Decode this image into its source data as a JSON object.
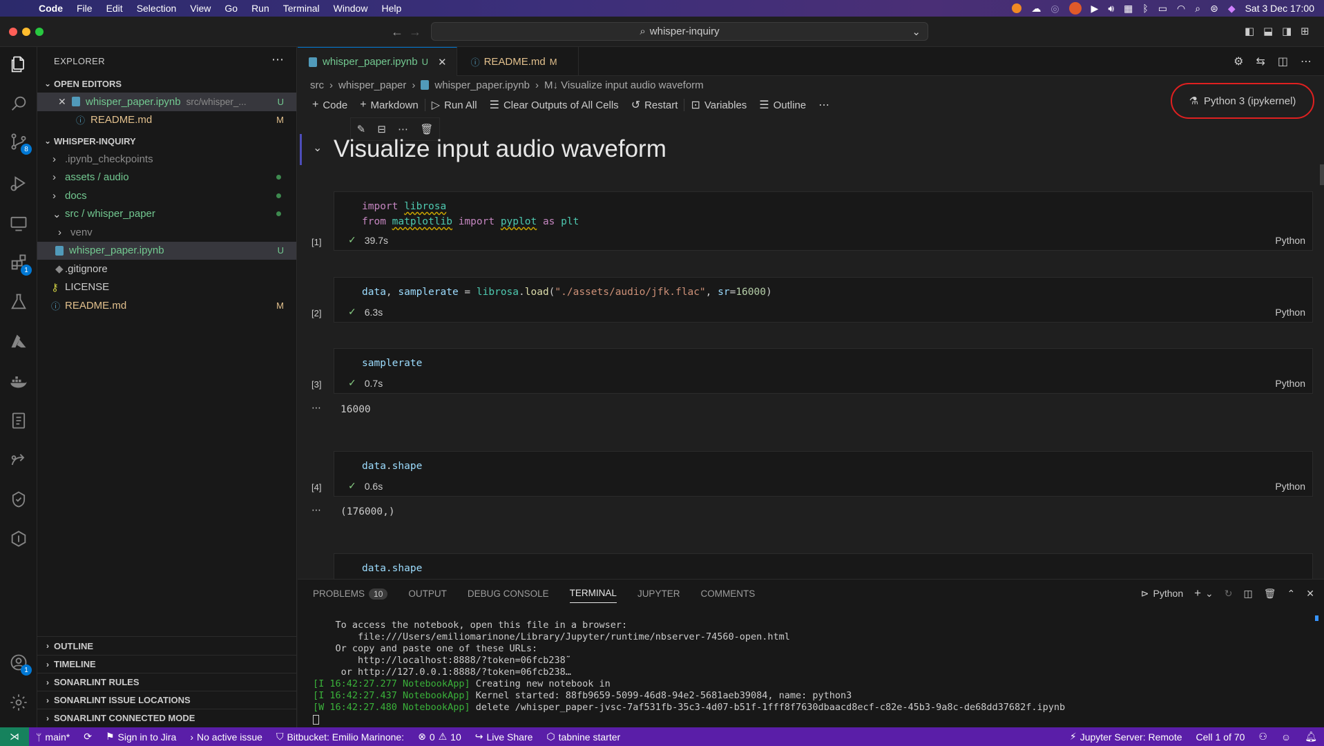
{
  "menubar": {
    "app": "Code",
    "items": [
      "File",
      "Edit",
      "Selection",
      "View",
      "Go",
      "Run",
      "Terminal",
      "Window",
      "Help"
    ],
    "clock": "Sat 3 Dec  17:00"
  },
  "titlebar": {
    "search": "whisper-inquiry"
  },
  "activity": {
    "scm_badge": "8",
    "ext_badge": "1",
    "account_badge": "1"
  },
  "sidebar": {
    "title": "EXPLORER",
    "open_editors_title": "OPEN EDITORS",
    "open_editors": [
      {
        "name": "whisper_paper.ipynb",
        "path": "src/whisper_...",
        "deco": "U"
      },
      {
        "name": "README.md",
        "path": "",
        "deco": "M"
      }
    ],
    "workspace_title": "WHISPER-INQUIRY",
    "tree": [
      {
        "name": ".ipynb_checkpoints"
      },
      {
        "name": "assets / audio"
      },
      {
        "name": "docs"
      },
      {
        "name": "src / whisper_paper"
      },
      {
        "name": "venv"
      },
      {
        "name": "whisper_paper.ipynb",
        "deco": "U"
      },
      {
        "name": ".gitignore"
      },
      {
        "name": "LICENSE"
      },
      {
        "name": "README.md",
        "deco": "M"
      }
    ],
    "bottom_sections": [
      "OUTLINE",
      "TIMELINE",
      "SONARLINT RULES",
      "SONARLINT ISSUE LOCATIONS",
      "SONARLINT CONNECTED MODE"
    ]
  },
  "tabs": [
    {
      "label": "whisper_paper.ipynb",
      "deco": "U"
    },
    {
      "label": "README.md",
      "deco": "M"
    }
  ],
  "breadcrumb": [
    "src",
    "whisper_paper",
    "whisper_paper.ipynb",
    "M↓ Visualize input audio waveform"
  ],
  "toolbar": {
    "code": "Code",
    "markdown": "Markdown",
    "run_all": "Run All",
    "clear": "Clear Outputs of All Cells",
    "restart": "Restart",
    "variables": "Variables",
    "outline": "Outline",
    "kernel": "Python 3 (ipykernel)"
  },
  "notebook": {
    "heading": "Visualize input audio waveform",
    "cells": [
      {
        "count": "[1]",
        "time": "39.7s",
        "lang": "Python"
      },
      {
        "count": "[2]",
        "time": "6.3s",
        "lang": "Python"
      },
      {
        "count": "[3]",
        "time": "0.7s",
        "lang": "Python",
        "output": "16000"
      },
      {
        "count": "[4]",
        "time": "0.6s",
        "lang": "Python",
        "output": "(176000,)"
      }
    ],
    "cell5_code": "data.shape"
  },
  "panel": {
    "tabs": [
      "PROBLEMS",
      "OUTPUT",
      "DEBUG CONSOLE",
      "TERMINAL",
      "JUPYTER",
      "COMMENTS"
    ],
    "problems_count": "10",
    "shell": "Python",
    "terminal_lines": [
      "    To access the notebook, open this file in a browser:",
      "        file:///Users/emiliomarinone/Library/Jupyter/runtime/nbserver-74560-open.html",
      "    Or copy and paste one of these URLs:",
      "        http://localhost:8888/?token=06fcb238˜",
      "     or http://127.0.0.1:8888/?token=06fcb238…"
    ],
    "log_lines": [
      {
        "prefix": "[I 16:42:27.277 NotebookApp]",
        "text": " Creating new notebook in"
      },
      {
        "prefix": "[I 16:42:27.437 NotebookApp]",
        "text": " Kernel started: 88fb9659-5099-46d8-94e2-5681aeb39084, name: python3"
      },
      {
        "prefix": "[W 16:42:27.480 NotebookApp]",
        "text": " delete /whisper_paper-jvsc-7af531fb-35c3-4d07-b51f-1fff8f7630dbaacd8ecf-c82e-45b3-9a8c-de68dd37682f.ipynb"
      }
    ]
  },
  "statusbar": {
    "branch": "main*",
    "jira": "Sign in to Jira",
    "issue": "No active issue",
    "bitbucket": "Bitbucket: Emilio Marinone:",
    "errors": "0",
    "warnings": "10",
    "liveshare": "Live Share",
    "tabnine": "tabnine starter",
    "jupyter": "Jupyter Server: Remote",
    "cell": "Cell 1 of 70"
  },
  "colors": {
    "accent": "#0078d4",
    "statusbar": "#5a1ea8",
    "kernel_highlight": "#e02020",
    "untracked": "#73c991"
  }
}
